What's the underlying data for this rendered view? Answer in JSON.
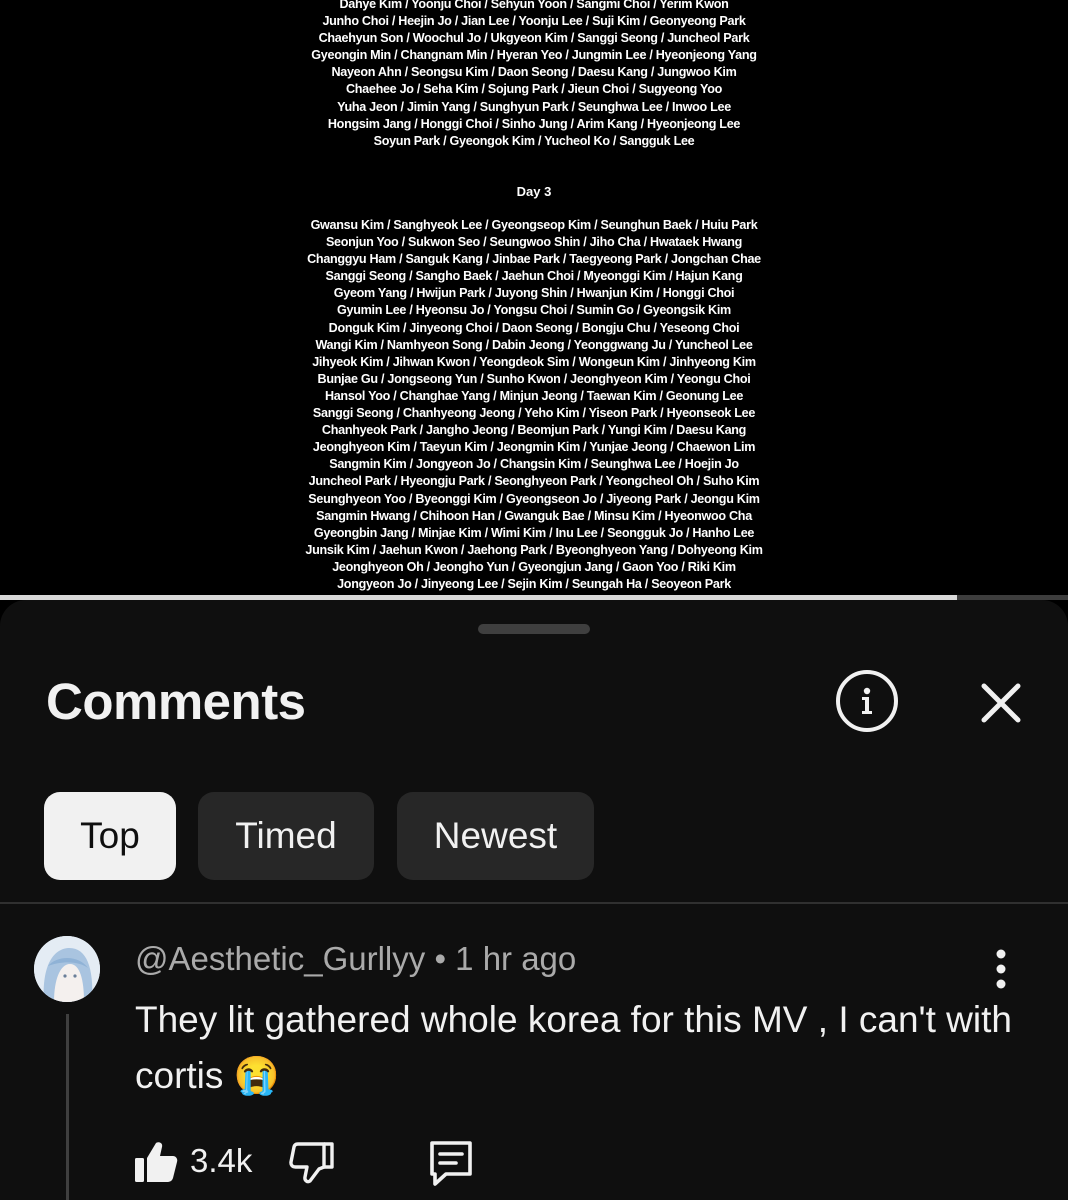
{
  "video": {
    "credits_top": [
      "Dahye Kim / Yoonju Choi / Sehyun Yoon / Sangmi Choi / Yerim Kwon",
      "Junho Choi / Heejin Jo / Jian Lee / Yoonju Lee / Suji Kim / Geonyeong Park",
      "Chaehyun Son / Woochul Jo / Ukgyeon Kim / Sanggi Seong / Juncheol Park",
      "Gyeongin Min / Changnam Min / Hyeran Yeo / Jungmin Lee / Hyeonjeong Yang",
      "Nayeon Ahn / Seongsu Kim / Daon Seong / Daesu Kang / Jungwoo Kim",
      "Chaehee Jo / Seha Kim / Sojung Park / Jieun Choi / Sugyeong Yoo",
      "Yuha Jeon / Jimin Yang / Sunghyun Park / Seunghwa Lee / Inwoo Lee",
      "Hongsim Jang / Honggi Choi / Sinho Jung / Arim Kang / Hyeonjeong Lee",
      "Soyun Park / Gyeongok Kim / Yucheol Ko / Sangguk Lee"
    ],
    "day_label": "Day 3",
    "credits_day3": [
      "Gwansu Kim / Sanghyeok Lee / Gyeongseop Kim / Seunghun Baek / Huiu Park",
      "Seonjun Yoo / Sukwon Seo / Seungwoo Shin / Jiho Cha / Hwataek Hwang",
      "Changgyu Ham / Sanguk Kang / Jinbae Park / Taegyeong Park / Jongchan Chae",
      "Sanggi Seong / Sangho Baek / Jaehun Choi / Myeonggi Kim / Hajun Kang",
      "Gyeom Yang / Hwijun Park / Juyong Shin / Hwanjun Kim / Honggi Choi",
      "Gyumin Lee / Hyeonsu Jo / Yongsu Choi / Sumin Go / Gyeongsik Kim",
      "Donguk Kim / Jinyeong Choi / Daon Seong / Bongju Chu / Yeseong Choi",
      "Wangi Kim / Namhyeon Song / Dabin Jeong / Yeonggwang Ju / Yuncheol Lee",
      "Jihyeok Kim / Jihwan Kwon / Yeongdeok Sim / Wongeun Kim / Jinhyeong Kim",
      "Bunjae Gu / Jongseong Yun / Sunho Kwon / Jeonghyeon Kim / Yeongu Choi",
      "Hansol Yoo / Changhae Yang / Minjun Jeong / Taewan Kim / Geonung Lee",
      "Sanggi Seong / Chanhyeong Jeong / Yeho Kim / Yiseon Park / Hyeonseok Lee",
      "Chanhyeok Park / Jangho Jeong / Beomjun Park / Yungi Kim / Daesu Kang",
      "Jeonghyeon Kim / Taeyun Kim / Jeongmin Kim / Yunjae Jeong / Chaewon Lim",
      "Sangmin Kim / Jongyeon Jo / Changsin Kim / Seunghwa Lee / Hoejin Jo",
      "Juncheol Park / Hyeongju Park / Seonghyeon Park / Yeongcheol Oh / Suho Kim",
      "Seunghyeon Yoo / Byeonggi Kim / Gyeongseon Jo / Jiyeong Park / Jeongu Kim",
      "Sangmin Hwang / Chihoon Han / Gwanguk Bae / Minsu Kim / Hyeonwoo Cha",
      "Gyeongbin Jang / Minjae Kim / Wimi Kim / Inu Lee / Seongguk Jo / Hanho Lee",
      "Junsik Kim / Jaehun Kwon / Jaehong Park / Byeonghyeon Yang / Dohyeong Kim",
      "Jeonghyeon Oh / Jeongho Yun / Gyeongjun Jang / Gaon Yoo / Riki Kim",
      "Jongyeon Jo / Jinyeong Lee / Sejin Kim / Seungah Ha / Seoyeon Park"
    ],
    "progress_fraction": 0.896
  },
  "comments_panel": {
    "title": "Comments",
    "info_icon": "info-icon",
    "close_icon": "close-icon",
    "tabs": [
      {
        "label": "Top",
        "selected": true
      },
      {
        "label": "Timed",
        "selected": false
      },
      {
        "label": "Newest",
        "selected": false
      }
    ],
    "comment": {
      "author": "@Aesthetic_Gurllyy",
      "separator": "•",
      "time": "1 hr ago",
      "text": "They lit gathered whole korea for this MV , I can't with cortis",
      "emoji": "😭",
      "like_count": "3.4k"
    }
  },
  "colors": {
    "background": "#0f0f0f",
    "chip_selected": "#f1f1f1",
    "chip": "#272727",
    "meta_text": "#aaaaaa"
  }
}
